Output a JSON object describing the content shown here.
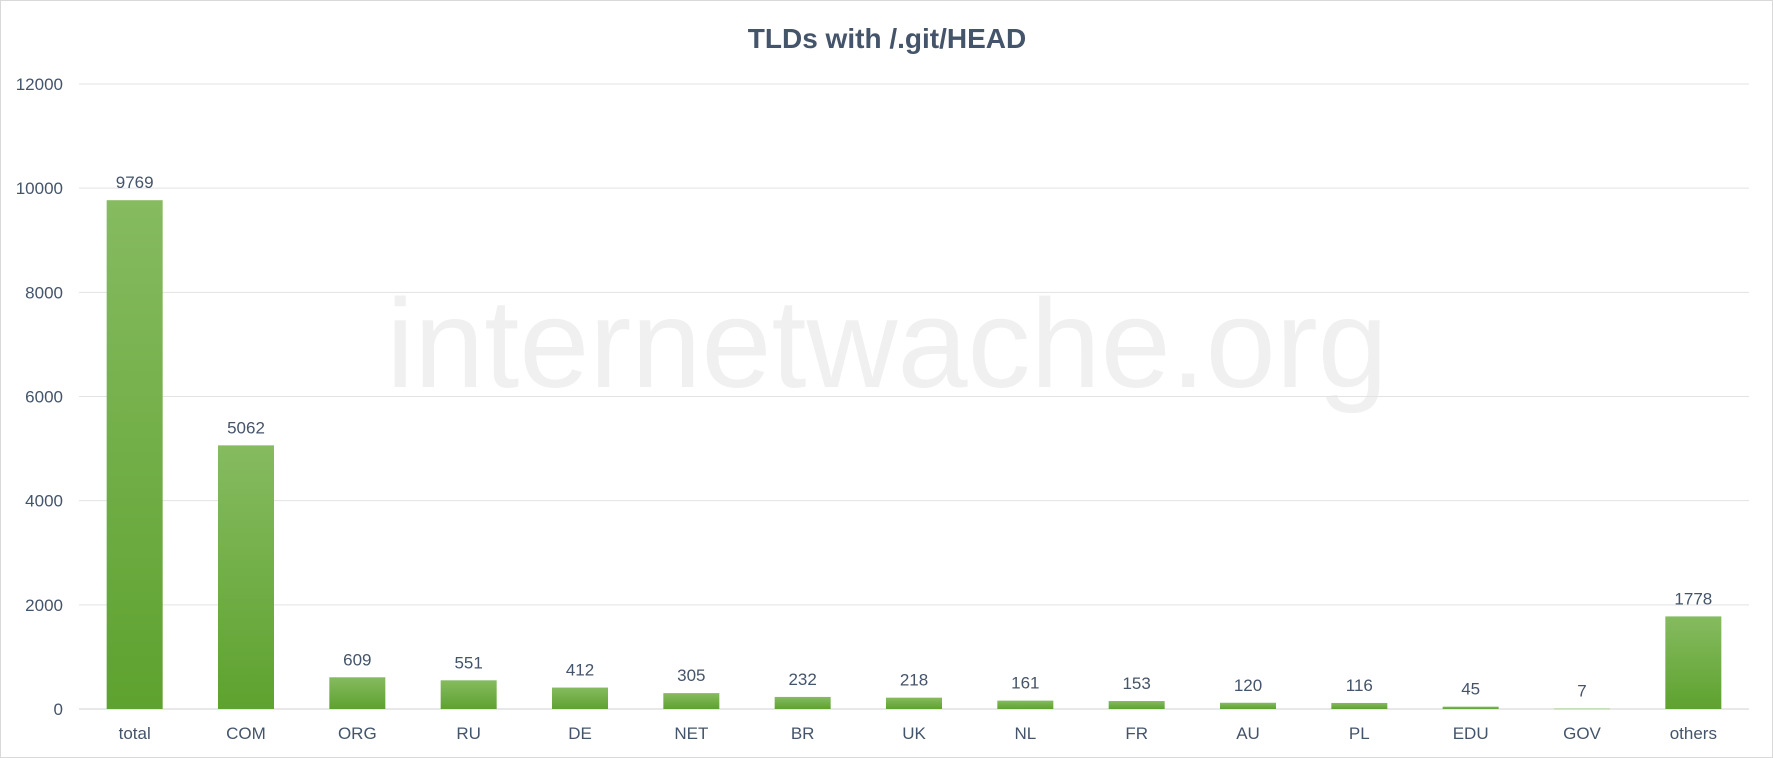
{
  "watermark": "internetwache.org",
  "colors": {
    "bar_top": "#86bb60",
    "bar_bottom": "#5ea22f",
    "text": "#44546a",
    "grid": "#e3e3e3"
  },
  "chart_data": {
    "type": "bar",
    "title": "TLDs with /.git/HEAD",
    "xlabel": "",
    "ylabel": "",
    "categories": [
      "total",
      "COM",
      "ORG",
      "RU",
      "DE",
      "NET",
      "BR",
      "UK",
      "NL",
      "FR",
      "AU",
      "PL",
      "EDU",
      "GOV",
      "others"
    ],
    "values": [
      9769,
      5062,
      609,
      551,
      412,
      305,
      232,
      218,
      161,
      153,
      120,
      116,
      45,
      7,
      1778
    ],
    "ylim": [
      0,
      12000
    ],
    "yticks": [
      0,
      2000,
      4000,
      6000,
      8000,
      10000,
      12000
    ],
    "grid": true,
    "legend": "none",
    "data_labels": true
  }
}
